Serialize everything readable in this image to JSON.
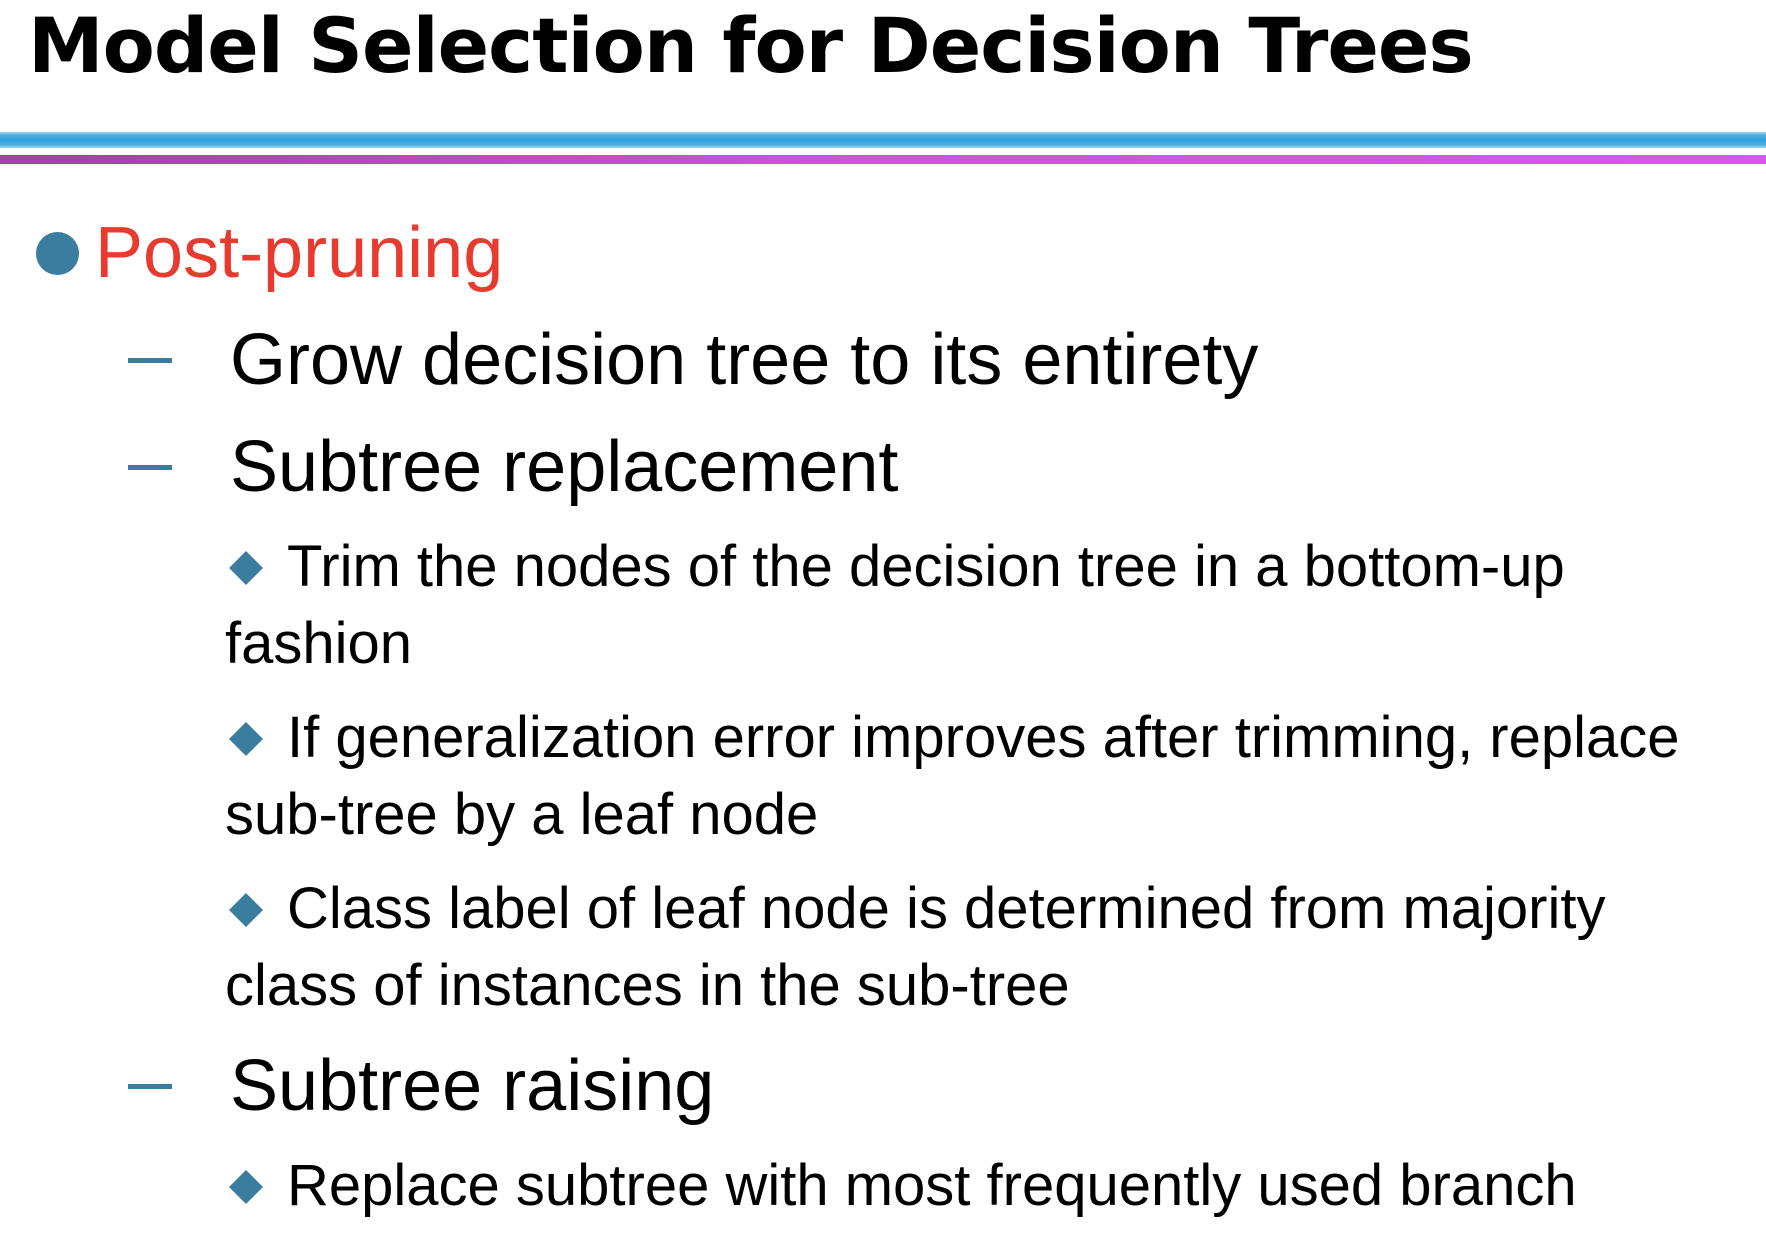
{
  "title": "Model Selection for Decision Trees",
  "level1": {
    "text": "Post-pruning",
    "color": "#e63b2e"
  },
  "items": [
    {
      "text": "Grow decision tree to its entirety"
    },
    {
      "text": "Subtree replacement"
    },
    {
      "text": "Subtree raising"
    }
  ],
  "subitems": {
    "subtree_replacement": [
      "Trim the nodes of the decision tree in a bottom-up fashion",
      "If generalization error improves after trimming, replace sub-tree by a leaf node",
      "Class label of leaf node is determined from majority class of instances in the sub-tree"
    ],
    "subtree_raising": [
      "Replace subtree with most frequently used branch"
    ]
  },
  "colors": {
    "bullet": "#3a7d9f",
    "rule_top": "#2d9fd8",
    "rule_bottom": "#d24ee0"
  }
}
